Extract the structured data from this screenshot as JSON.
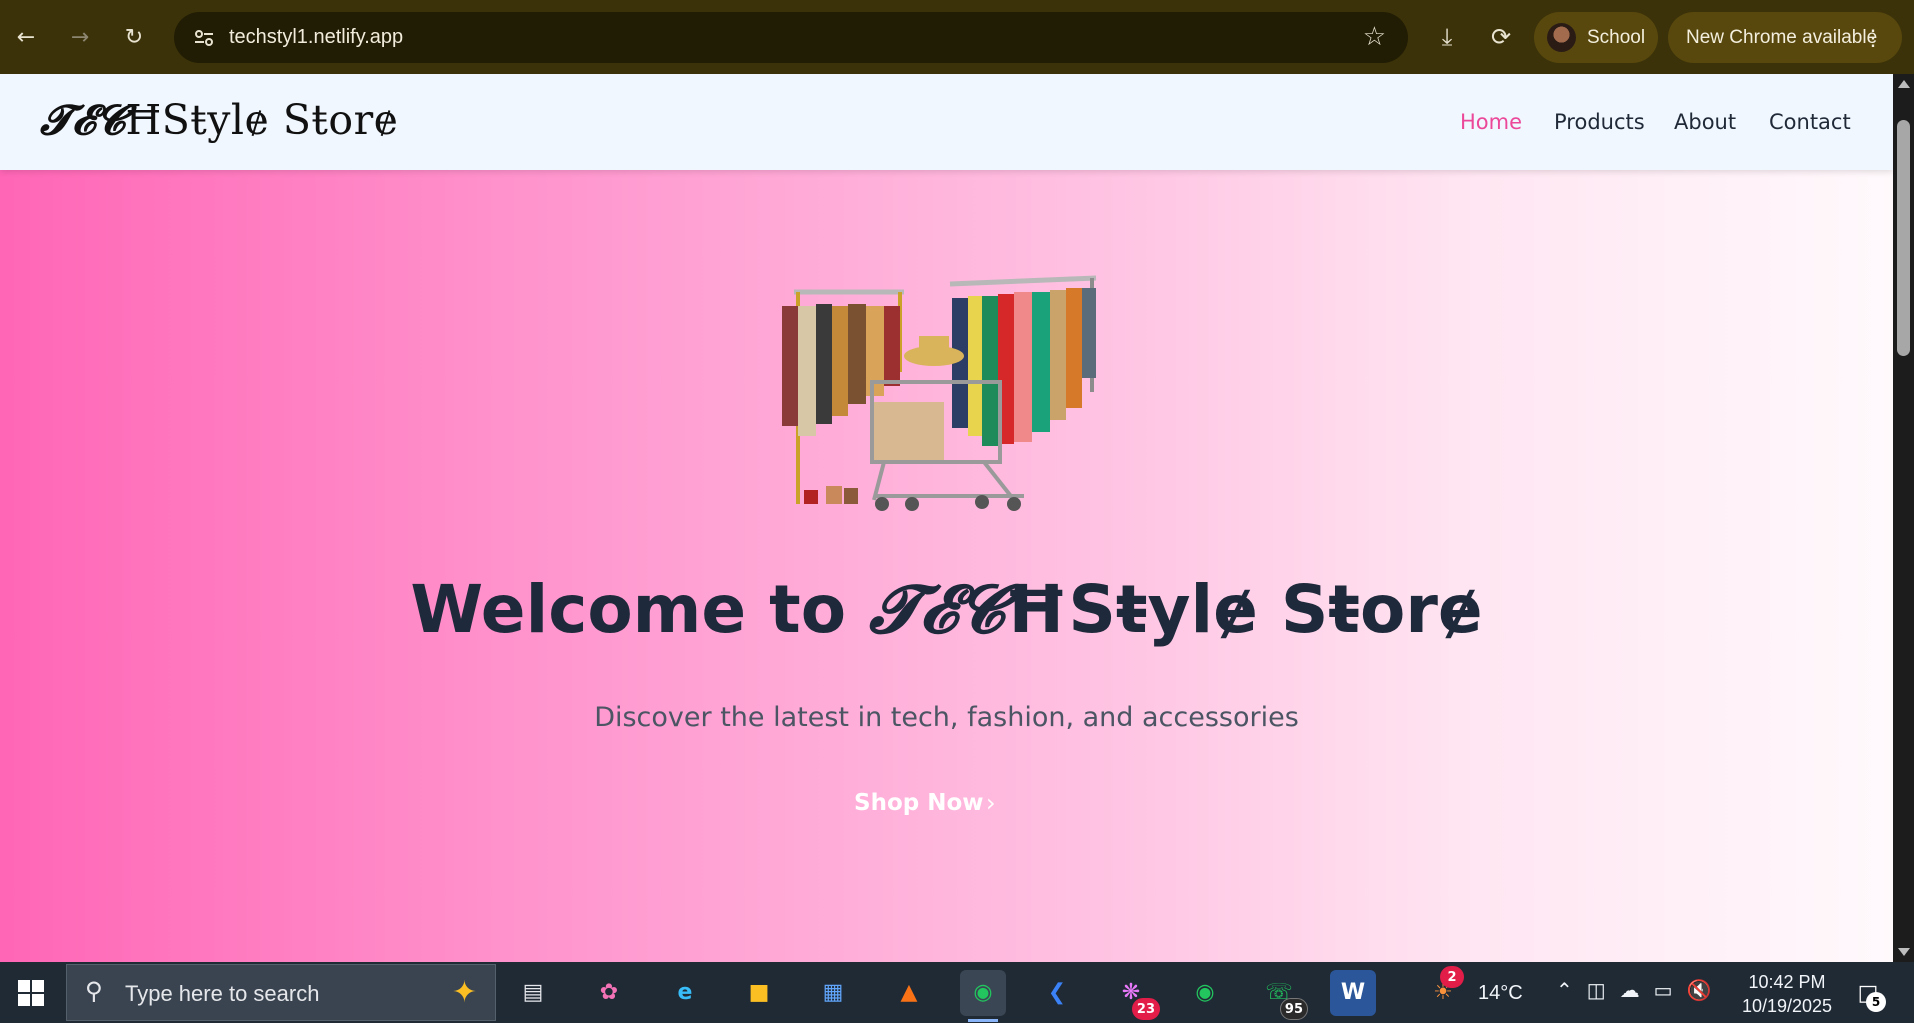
{
  "browser": {
    "url": "techstyl1.netlify.app",
    "profile_label": "School",
    "update_label": "New Chrome available",
    "icons": [
      "back-arrow-icon",
      "forward-arrow-icon",
      "reload-icon",
      "site-settings-icon",
      "bookmark-star-icon",
      "download-icon",
      "performance-icon",
      "menu-dots-icon"
    ]
  },
  "site": {
    "logo_script": "𝓣𝓔𝓒",
    "logo_rest": "ĦSŧylɇ Sŧorɇ",
    "nav": [
      {
        "label": "Home",
        "active": true
      },
      {
        "label": "Products",
        "active": false
      },
      {
        "label": "About",
        "active": false
      },
      {
        "label": "Contact",
        "active": false
      }
    ],
    "hero": {
      "title_prefix": "Welcome to ",
      "title_script": "𝓣𝓔𝓒",
      "title_rest": "ĦSŧylɇ Sŧorɇ",
      "subtitle": "Discover the latest in tech, fashion, and accessories",
      "cta_label": "Shop Now",
      "cta_icon": "chevron-right-icon",
      "image": "clothing-racks-with-shopping-cart"
    },
    "colors": {
      "accent": "#ec4899",
      "header_bg": "#f0f7ff",
      "title": "#1e293b",
      "gradient_start": "#ff66b6",
      "gradient_end": "#fff9fc"
    }
  },
  "taskbar": {
    "search_placeholder": "Type here to search",
    "apps": [
      {
        "name": "task-view",
        "badge": ""
      },
      {
        "name": "copilot",
        "badge": ""
      },
      {
        "name": "edge",
        "badge": ""
      },
      {
        "name": "file-explorer",
        "badge": ""
      },
      {
        "name": "microsoft-store",
        "badge": ""
      },
      {
        "name": "vlc",
        "badge": ""
      },
      {
        "name": "chrome",
        "badge": ""
      },
      {
        "name": "vscode",
        "badge": ""
      },
      {
        "name": "slack",
        "badge": "23"
      },
      {
        "name": "chrome-profile",
        "badge": ""
      },
      {
        "name": "whatsapp",
        "badge": "95"
      },
      {
        "name": "word",
        "badge": ""
      }
    ],
    "weather_badge": "2",
    "temperature": "14°C",
    "time": "10:42 PM",
    "date": "10/19/2025",
    "notification_count": "5"
  }
}
